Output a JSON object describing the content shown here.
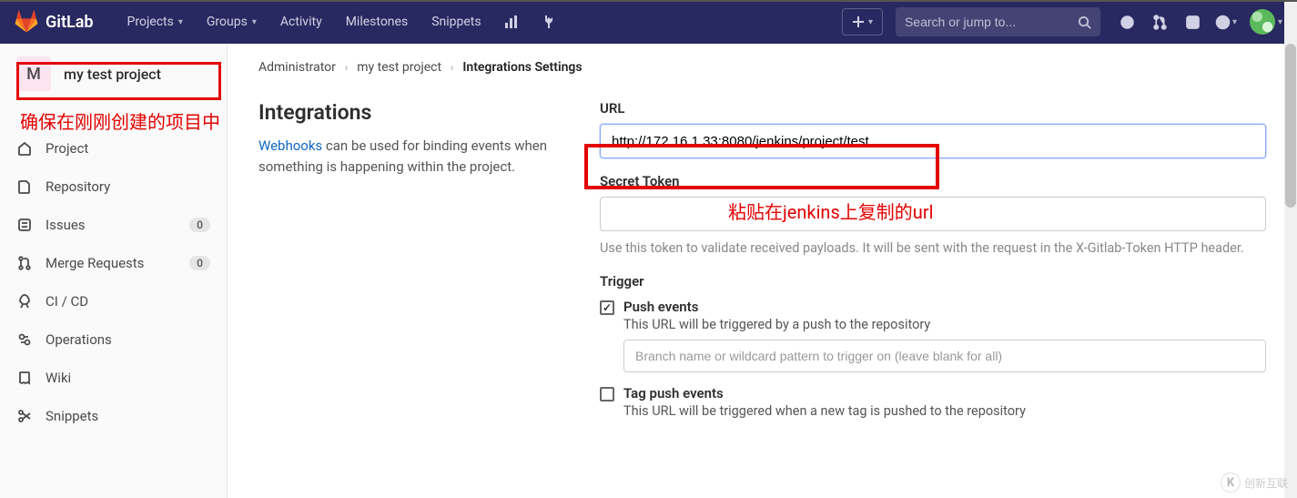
{
  "brand": "GitLab",
  "nav": {
    "projects": "Projects",
    "groups": "Groups",
    "activity": "Activity",
    "milestones": "Milestones",
    "snippets": "Snippets"
  },
  "search": {
    "placeholder": "Search or jump to..."
  },
  "project": {
    "avatar_letter": "M",
    "name": "my test project"
  },
  "sidebar": {
    "items": [
      {
        "label": "Project"
      },
      {
        "label": "Repository"
      },
      {
        "label": "Issues",
        "badge": "0"
      },
      {
        "label": "Merge Requests",
        "badge": "0"
      },
      {
        "label": "CI / CD"
      },
      {
        "label": "Operations"
      },
      {
        "label": "Wiki"
      },
      {
        "label": "Snippets"
      }
    ]
  },
  "breadcrumb": {
    "a": "Administrator",
    "b": "my test project",
    "c": "Integrations Settings"
  },
  "page": {
    "title": "Integrations",
    "desc_link": "Webhooks",
    "desc_rest": " can be used for binding events when something is happening within the project."
  },
  "form": {
    "url_label": "URL",
    "url_value": "http://172.16.1.33:8080/jenkins/project/test",
    "token_label": "Secret Token",
    "token_value": "",
    "token_hint": "Use this token to validate received payloads. It will be sent with the request in the X-Gitlab-Token HTTP header.",
    "trigger_label": "Trigger",
    "push": {
      "title": "Push events",
      "desc": "This URL will be triggered by a push to the repository",
      "placeholder": "Branch name or wildcard pattern to trigger on (leave blank for all)"
    },
    "tag": {
      "title": "Tag push events",
      "desc": "This URL will be triggered when a new tag is pushed to the repository"
    }
  },
  "annotations": {
    "left": "确保在刚刚创建的项目中",
    "right": "粘贴在jenkins上复制的url"
  },
  "watermark": "创新互联"
}
